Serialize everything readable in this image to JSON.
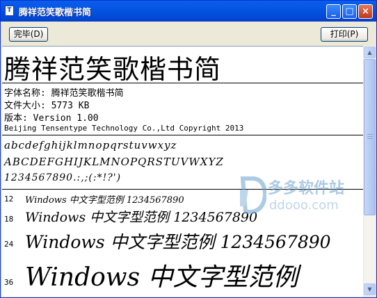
{
  "window": {
    "title": "腾祥范笑歌楷书简",
    "minimize": "_",
    "maximize": "□",
    "close": "×"
  },
  "toolbar": {
    "finish_label": "完毕(D)",
    "print_label": "打印(P)"
  },
  "preview": {
    "font_title": "腾祥范笑歌楷书简",
    "info": {
      "name_line": "字体名称: 腾祥范笑歌楷书简",
      "size_line": "文件大小: 5773 KB",
      "version_line": "版本: Version 1.00",
      "copyright_line": "Beijing Tensentype Technology Co.,Ltd  Copyright 2013"
    },
    "charsets": {
      "lower": "abcdefghijklmnopqrstuvwxyz",
      "upper": "ABCDEFGHIJKLMNOPQRSTUVWXYZ",
      "digits": "1234567890.:,;(:*!?')"
    },
    "sizes": [
      {
        "label": "12",
        "text": "Windows 中文字型范例 1234567890"
      },
      {
        "label": "18",
        "text": "Windows 中文字型范例 1234567890"
      },
      {
        "label": "24",
        "text": "Windows 中文字型范例 1234567890"
      },
      {
        "label": "36",
        "text": "Windows 中文字型范例"
      }
    ]
  },
  "watermark": {
    "cn": "多多软件站",
    "en": "ddooo.com"
  },
  "colors": {
    "title_bar": "#0a5ee9",
    "close_button": "#c2351b",
    "watermark": "#6aa1cf"
  }
}
